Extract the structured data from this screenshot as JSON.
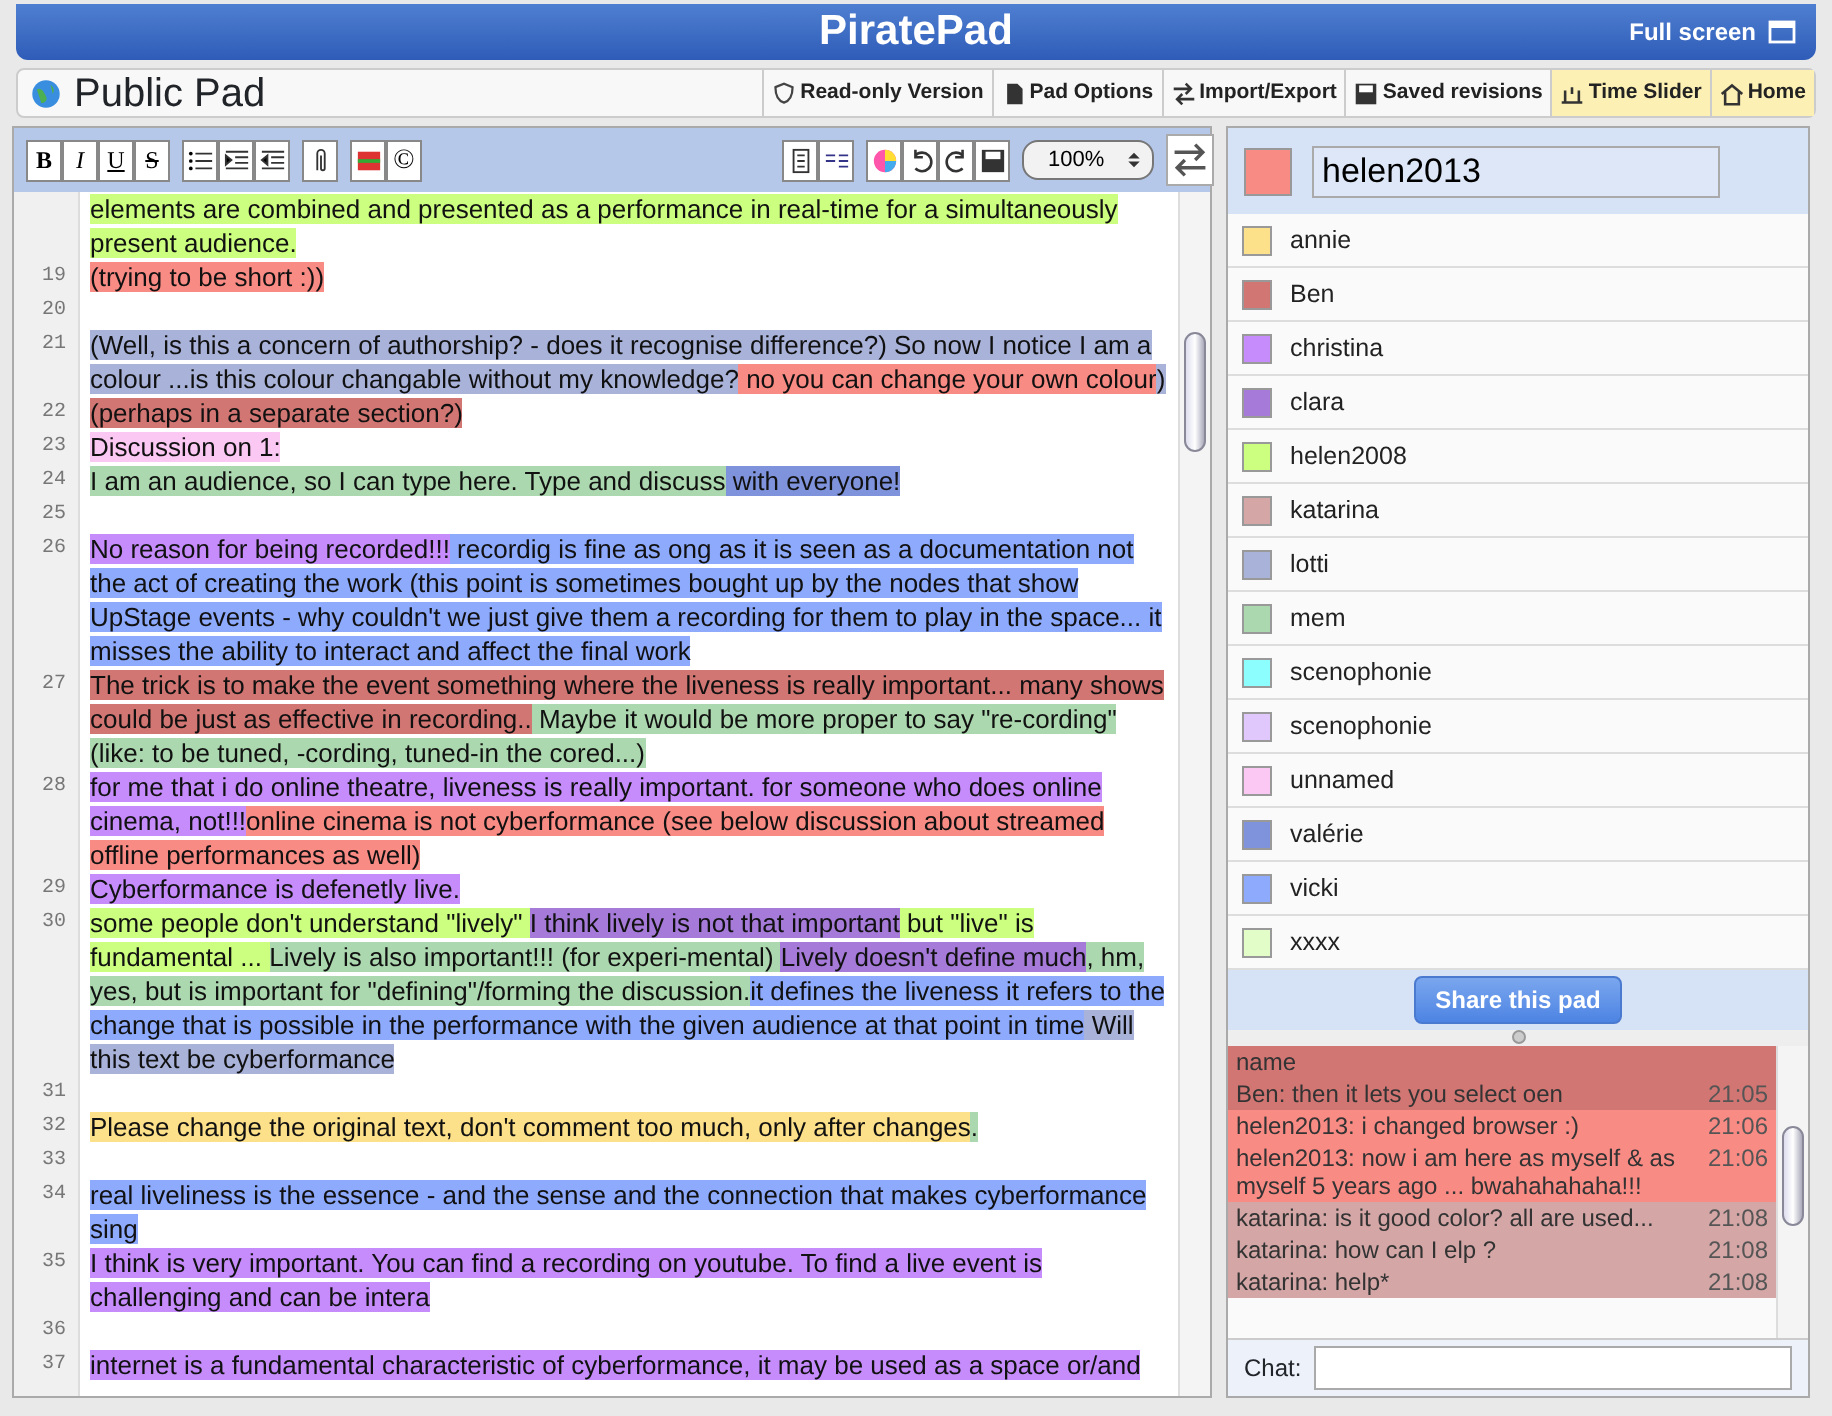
{
  "header": {
    "title": "PiratePad",
    "fullscreen": "Full screen"
  },
  "padbar": {
    "title": "Public Pad",
    "buttons": [
      {
        "label": "Read-only Version",
        "highlighted": false
      },
      {
        "label": "Pad Options",
        "highlighted": false
      },
      {
        "label": "Import/Export",
        "highlighted": false
      },
      {
        "label": "Saved revisions",
        "highlighted": false
      },
      {
        "label": "Time Slider",
        "highlighted": true
      },
      {
        "label": "Home",
        "highlighted": true
      }
    ]
  },
  "toolbar": {
    "format_buttons": [
      "B",
      "I",
      "U",
      "S"
    ],
    "copyright": "©",
    "zoom": "100%"
  },
  "editor": {
    "lines": [
      {
        "segments": [
          {
            "text": "elements are combined and presented as a performance in real-time for a simultaneously present audience.",
            "color": "#ccfe7f"
          }
        ]
      },
      {
        "number": "19",
        "segments": [
          {
            "text": "(trying to be short :))",
            "color": "#f98b85"
          }
        ]
      },
      {
        "number": "20"
      },
      {
        "number": "21",
        "segments": [
          {
            "text": "(Well, is this a concern of authorship? - does it recognise difference?) So now I notice I am a colour ...is this colour changable without my knowledge?",
            "color": "#a9b3d9"
          },
          {
            "text": " no you can change your own colour",
            "color": "#f98b85"
          },
          {
            "text": ")",
            "color": "#a9b3d9"
          }
        ]
      },
      {
        "number": "22",
        "segments": [
          {
            "text": " (perhaps in a separate section?)",
            "color": "#d27673"
          }
        ]
      },
      {
        "number": "23",
        "segments": [
          {
            "text": "Discussion  on 1:",
            "color": "#fac8f2"
          }
        ]
      },
      {
        "number": "24",
        "segments": [
          {
            "text": "I am an audience, so I can type here. Type and discuss",
            "color": "#acd8af"
          },
          {
            "text": " with everyone!",
            "color": "#7f93dc"
          }
        ]
      },
      {
        "number": "25"
      },
      {
        "number": "26",
        "segments": [
          {
            "text": "No reason for being recorded!!!",
            "color": "#c68cfc"
          },
          {
            "text": " recordig is fine as ong as it is seen as a documentation not the act of creating the work (this point is sometimes bought up by the nodes that show UpStage events - why couldn't we just give them a recording for them to play in the space... it misses the ability to interact and affect the final work",
            "color": "#8eaafc"
          }
        ]
      },
      {
        "number": "27",
        "segments": [
          {
            "text": "The trick is to make the event something where the liveness is really important... many shows could be just as effective in recording..",
            "color": "#d27673"
          },
          {
            "text": " Maybe it would be more proper to say \"re-cording\" (like: to be tuned, -cording, tuned-in the cored...)",
            "color": "#acd8af"
          }
        ]
      },
      {
        "number": "28",
        "segments": [
          {
            "text": "for me that i do online theatre, liveness is really important. for someone who does online cinema, not!!!",
            "color": "#c68cfc"
          },
          {
            "text": "online cinema is not cyberformance (see below discussion about streamed offline performances as well)",
            "color": "#f98b85"
          }
        ]
      },
      {
        "number": "29",
        "segments": [
          {
            "text": "Cyberformance is defenetly live.",
            "color": "#c68cfc"
          }
        ]
      },
      {
        "number": "30",
        "segments": [
          {
            "text": "some people don't understand \"lively\" ",
            "color": "#ccfe7f"
          },
          {
            "text": "I think lively is not that important",
            "color": "#a57ad8"
          },
          {
            "text": " but \"live\" is fundamental ... ",
            "color": "#ccfe7f"
          },
          {
            "text": "Lively is also important!!! (for experi-mental) ",
            "color": "#acd8af"
          },
          {
            "text": "Lively doesn't define much",
            "color": "#a57ad8"
          },
          {
            "text": ", hm, yes, but is important for \"defining\"/forming the discussion.",
            "color": "#acd8af"
          },
          {
            "text": "it defines the liveness it refers to the change that is possible in the performance with the given audience at that point in time",
            "color": "#8eaafc"
          },
          {
            "text": " Will this text be cyberformance",
            "color": "#a9b3d9"
          }
        ]
      },
      {
        "number": "31"
      },
      {
        "number": "32",
        "segments": [
          {
            "text": "Please change the original text, don't comment too much, only after changes",
            "color": "#fde08a"
          },
          {
            "text": ".",
            "color": "#acd8af"
          }
        ]
      },
      {
        "number": "33"
      },
      {
        "number": "34",
        "segments": [
          {
            "text": "real liveliness is the essence - and the sense and the connection that makes cyberformance sing",
            "color": "#8eaafc"
          }
        ]
      },
      {
        "number": "35",
        "segments": [
          {
            "text": "I think is very important. You can find a recording on youtube. To find a live event is challenging and can be intera",
            "color": "#c68cfc"
          }
        ]
      },
      {
        "number": "36"
      },
      {
        "number": "37",
        "segments": [
          {
            "text": "internet is a fundamental characteristic of cyberformance, it may be used as a space or/and",
            "color": "#c68cfc"
          }
        ]
      }
    ]
  },
  "me": {
    "name": "helen2013",
    "color": "#f98b85"
  },
  "users": [
    {
      "name": "annie",
      "color": "#fde08a"
    },
    {
      "name": "Ben",
      "color": "#d27673"
    },
    {
      "name": "christina",
      "color": "#c68cfc"
    },
    {
      "name": "clara",
      "color": "#a57ad8"
    },
    {
      "name": "helen2008",
      "color": "#ccfe7f"
    },
    {
      "name": "katarina",
      "color": "#d4a6a6"
    },
    {
      "name": "lotti",
      "color": "#a9b3d9"
    },
    {
      "name": "mem",
      "color": "#acd8af"
    },
    {
      "name": "scenophonie",
      "color": "#8dfefe"
    },
    {
      "name": "scenophonie",
      "color": "#e1c8fc"
    },
    {
      "name": "unnamed",
      "color": "#fac8f2"
    },
    {
      "name": "valérie",
      "color": "#7f93dc"
    },
    {
      "name": "vicki",
      "color": "#8eaafc"
    },
    {
      "name": "xxxx",
      "color": "#e3fdc8"
    }
  ],
  "share_button": "Share this pad",
  "chat": {
    "messages": [
      {
        "text": "name",
        "color": "#d27673"
      },
      {
        "text": "Ben: then it lets you select oen",
        "time": "21:05",
        "color": "#d27673"
      },
      {
        "text": "helen2013: i changed browser :)",
        "time": "21:06",
        "color": "#f98b85"
      },
      {
        "text": "helen2013: now i am here as myself & as myself 5 years ago ... bwahahahaha!!!",
        "time": "21:06",
        "color": "#f98b85"
      },
      {
        "text": "katarina: is it good color? all are used...",
        "time": "21:08",
        "color": "#d4a6a6"
      },
      {
        "text": "katarina: how can I elp ?",
        "time": "21:08",
        "color": "#d4a6a6"
      },
      {
        "text": "katarina: help*",
        "time": "21:08",
        "color": "#d4a6a6"
      }
    ],
    "label": "Chat:"
  }
}
